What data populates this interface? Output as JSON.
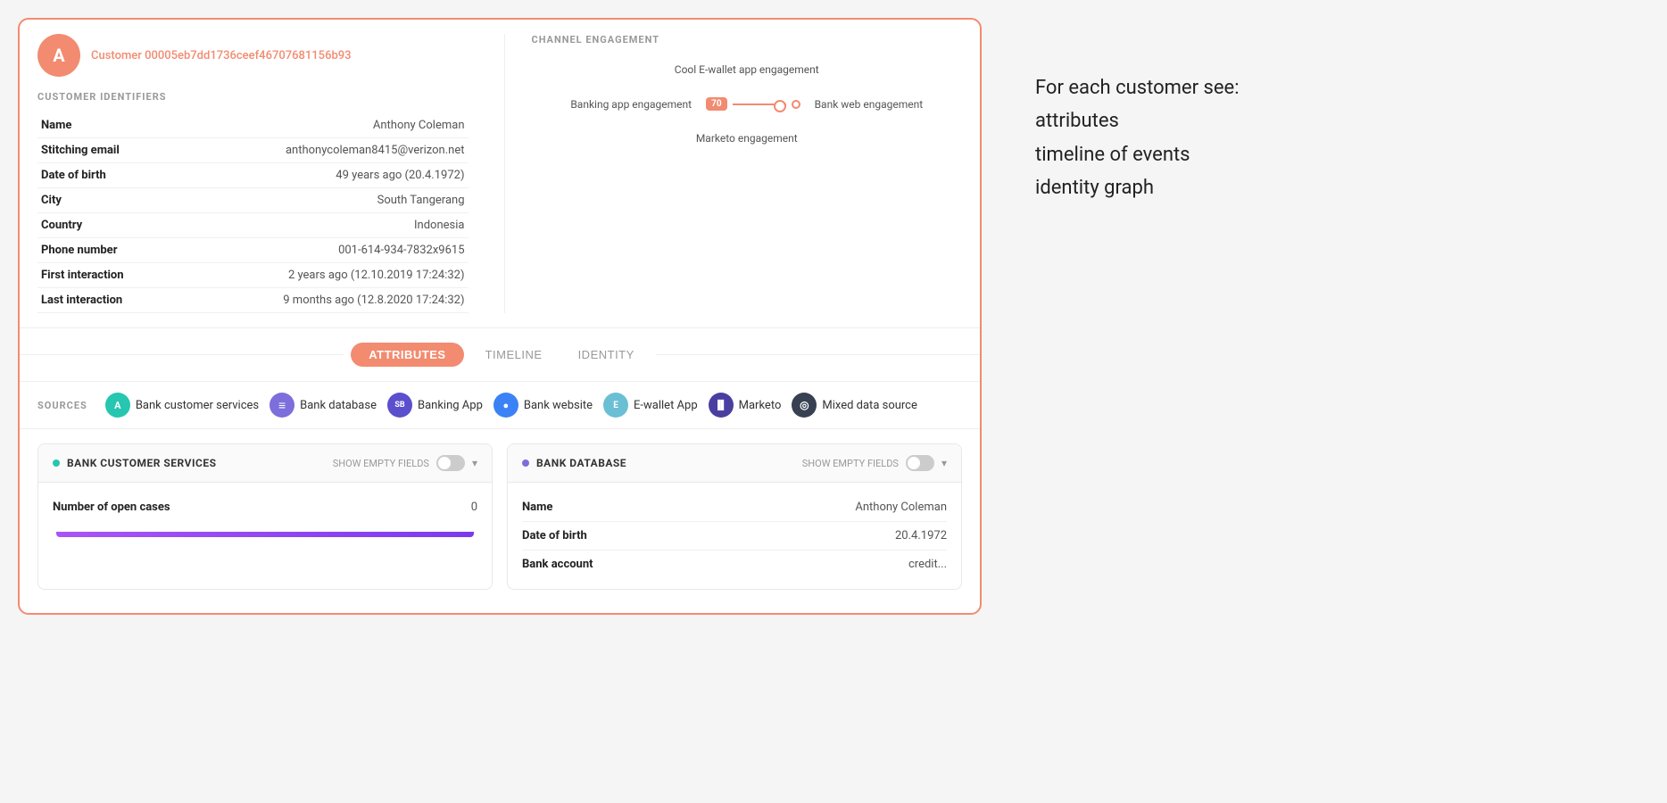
{
  "customer": {
    "id": "Customer 00005eb7dd1736ceef46707681156b93",
    "avatar_initial": "A",
    "name": "Anthony Coleman",
    "stitching_email": "anthonycoleman8415@verizon.net",
    "date_of_birth": "49 years ago (20.4.1972)",
    "city": "South Tangerang",
    "country": "Indonesia",
    "phone_number": "001-614-934-7832x9615",
    "first_interaction": "2 years ago (12.10.2019 17:24:32)",
    "last_interaction": "9 months ago (12.8.2020 17:24:32)"
  },
  "labels": {
    "customer_identifiers": "CUSTOMER IDENTIFIERS",
    "channel_engagement": "CHANNEL ENGAGEMENT",
    "name": "Name",
    "stitching_email": "Stitching email",
    "date_of_birth": "Date of birth",
    "city": "City",
    "country": "Country",
    "phone_number": "Phone number",
    "first_interaction": "First interaction",
    "last_interaction": "Last interaction"
  },
  "channels": {
    "top": "Cool E-wallet app engagement",
    "left": "Banking app engagement",
    "right": "Bank web engagement",
    "bottom": "Marketo engagement",
    "badge": "70"
  },
  "tabs": {
    "attributes": "ATTRIBUTES",
    "timeline": "TIMELINE",
    "identity": "IDENTITY"
  },
  "sources": {
    "label": "SOURCES",
    "items": [
      {
        "name": "Bank customer services",
        "icon_text": "A",
        "color": "#26c6b0"
      },
      {
        "name": "Bank database",
        "icon_text": "≡",
        "color": "#7c6edb"
      },
      {
        "name": "Banking App",
        "icon_text": "SB",
        "color": "#5b4fce"
      },
      {
        "name": "Bank website",
        "icon_text": "●",
        "color": "#3b82f6"
      },
      {
        "name": "E-wallet App",
        "icon_text": "E",
        "color": "#6bbfd4"
      },
      {
        "name": "Marketo",
        "icon_text": "▐▌",
        "color": "#4a3fa0"
      },
      {
        "name": "Mixed data source",
        "icon_text": "◎",
        "color": "#374151"
      }
    ]
  },
  "attr_cards": {
    "bank_customer_services": {
      "title": "BANK CUSTOMER SERVICES",
      "dot_color": "#26c6b0",
      "show_empty_label": "SHOW EMPTY FIELDS",
      "fields": [
        {
          "label": "Number of open cases",
          "value": "0"
        }
      ]
    },
    "bank_database": {
      "title": "BANK DATABASE",
      "dot_color": "#7c6edb",
      "show_empty_label": "SHOW EMPTY FIELDS",
      "fields": [
        {
          "label": "Name",
          "value": "Anthony Coleman"
        },
        {
          "label": "Date of birth",
          "value": "20.4.1972"
        },
        {
          "label": "Bank account",
          "value": "credit..."
        }
      ]
    }
  },
  "sidebar": {
    "text": "For each customer see:\nattributes\ntimeline of events\nidentity graph"
  }
}
